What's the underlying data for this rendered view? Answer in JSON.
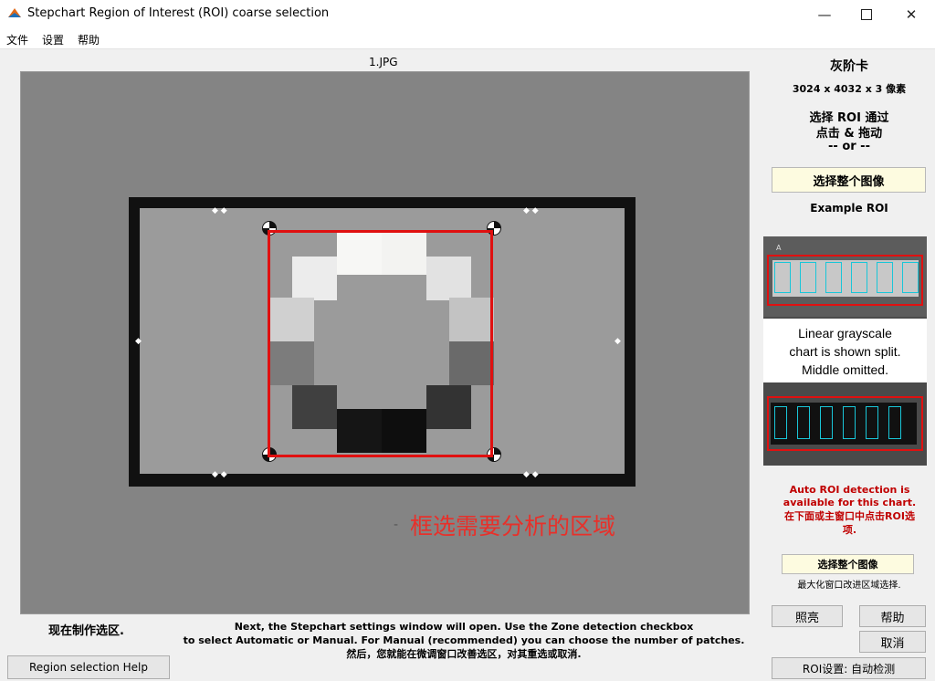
{
  "window": {
    "title": "Stepchart Region of Interest (ROI) coarse selection",
    "minimize_icon": "minimize-icon",
    "maximize_icon": "maximize-icon",
    "close_icon": "close-icon"
  },
  "menu": [
    "文件",
    "设置",
    "帮助"
  ],
  "image": {
    "filename": "1.JPG",
    "overlay_text": "框选需要分析的区域"
  },
  "panel": {
    "chart_type": "灰阶卡",
    "dimensions": "3024 x 4032 x 3  像素",
    "select_line1": "选择 ROI 通过",
    "select_line2": "点击 & 拖动",
    "select_or": "-- or --",
    "select_whole_button": "选择整个图像",
    "example_title": "Example ROI",
    "example_caption_1": "Linear grayscale",
    "example_caption_2": "chart is shown split.",
    "example_caption_3": "Middle omitted.",
    "auto_roi_line1": "Auto ROI detection is",
    "auto_roi_line2": "available for this chart.",
    "auto_roi_line3": "在下面或主窗口中点击ROI选",
    "auto_roi_line4": "项.",
    "select_whole_small_button": "选择整个图像",
    "maximize_hint": "最大化窗口改进区域选择.",
    "lighten_button": "照亮",
    "help_button": "帮助",
    "cancel_button": "取消",
    "roi_settings_button": "ROI设置: 自动检测"
  },
  "footer": {
    "status": "现在制作选区.",
    "info_line1": "Next, the Stepchart settings window will open. Use the Zone detection checkbox",
    "info_line2": "to select Automatic or Manual. For Manual (recommended) you can choose the number of patches.",
    "info_line3": "然后，您就能在微调窗口改善选区，对其重选或取消.",
    "region_help_button": "Region selection Help"
  },
  "colors": {
    "roi_red": "#e01010",
    "overlay_red": "#e8302a",
    "auto_text_red": "#c00000",
    "button_yellow": "#fdfbe0",
    "example_cyan": "#19c6d8"
  }
}
